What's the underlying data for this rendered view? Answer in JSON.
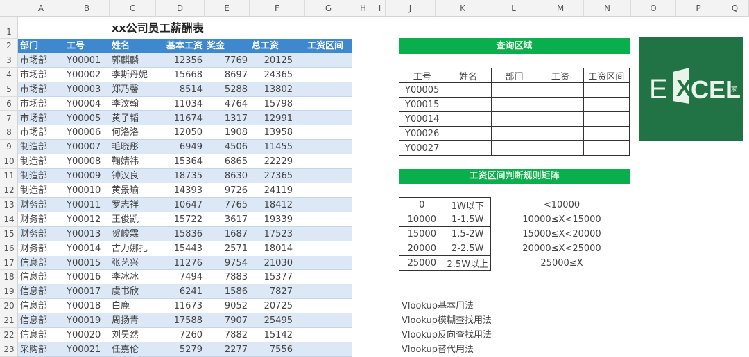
{
  "columns": [
    "A",
    "B",
    "C",
    "D",
    "E",
    "F",
    "G",
    "H",
    "I",
    "J",
    "K",
    "L",
    "M",
    "N",
    "O",
    "P",
    "Q"
  ],
  "salary_table": {
    "title": "xx公司员工薪酬表",
    "headers": [
      "部门",
      "工号",
      "姓名",
      "基本工资",
      "奖金",
      "总工资",
      "工资区间"
    ],
    "rows": [
      [
        "市场部",
        "Y00001",
        "郭麒麟",
        "12356",
        "7769",
        "20125"
      ],
      [
        "市场部",
        "Y00002",
        "李斯丹妮",
        "15668",
        "8697",
        "24365"
      ],
      [
        "市场部",
        "Y00003",
        "郑乃馨",
        "8514",
        "5288",
        "13802"
      ],
      [
        "市场部",
        "Y00004",
        "李汶翰",
        "11034",
        "4764",
        "15798"
      ],
      [
        "市场部",
        "Y00005",
        "黄子韬",
        "11674",
        "1317",
        "12991"
      ],
      [
        "市场部",
        "Y00006",
        "何洛洛",
        "12050",
        "1908",
        "13958"
      ],
      [
        "制造部",
        "Y00007",
        "毛晓彤",
        "6949",
        "4506",
        "11455"
      ],
      [
        "制造部",
        "Y00008",
        "鞠婧祎",
        "15364",
        "6865",
        "22229"
      ],
      [
        "制造部",
        "Y00009",
        "钟汉良",
        "18735",
        "8630",
        "27365"
      ],
      [
        "制造部",
        "Y00010",
        "黄景瑜",
        "14393",
        "9726",
        "24119"
      ],
      [
        "财务部",
        "Y00011",
        "罗志祥",
        "10647",
        "7765",
        "18412"
      ],
      [
        "财务部",
        "Y00012",
        "王俊凯",
        "15722",
        "3617",
        "19339"
      ],
      [
        "财务部",
        "Y00013",
        "贺峻霖",
        "15836",
        "1687",
        "17523"
      ],
      [
        "财务部",
        "Y00014",
        "古力娜扎",
        "15443",
        "2571",
        "18014"
      ],
      [
        "信息部",
        "Y00015",
        "张艺兴",
        "11276",
        "9754",
        "21030"
      ],
      [
        "信息部",
        "Y00016",
        "李冰冰",
        "7494",
        "7883",
        "15377"
      ],
      [
        "信息部",
        "Y00017",
        "虞书欣",
        "6241",
        "1586",
        "7827"
      ],
      [
        "信息部",
        "Y00018",
        "白鹿",
        "11673",
        "9052",
        "20725"
      ],
      [
        "信息部",
        "Y00019",
        "周扬青",
        "17588",
        "7907",
        "25495"
      ],
      [
        "信息部",
        "Y00020",
        "刘昊然",
        "7260",
        "7882",
        "15142"
      ],
      [
        "采购部",
        "Y00021",
        "任嘉伦",
        "5279",
        "2277",
        "7556"
      ]
    ]
  },
  "query": {
    "title": "查询区域",
    "headers": [
      "工号",
      "姓名",
      "部门",
      "工资",
      "工资区间"
    ],
    "ids": [
      "Y00005",
      "Y00015",
      "Y00014",
      "Y00026",
      "Y00027"
    ]
  },
  "rules": {
    "title": "工资区间判断规则矩阵",
    "rows": [
      [
        "0",
        "1W以下"
      ],
      [
        "10000",
        "1-1.5W"
      ],
      [
        "15000",
        "1.5-2W"
      ],
      [
        "20000",
        "2-2.5W"
      ],
      [
        "25000",
        "2.5W以上"
      ]
    ],
    "descriptions": [
      "<10000",
      "10000≤X<15000",
      "15000≤X<20000",
      "20000≤X<25000",
      "25000≤X"
    ]
  },
  "notes": [
    "Vlookup基本用法",
    "Vlookup模糊查找用法",
    "Vlookup反向查找用法",
    "Vlookup替代用法"
  ],
  "logo": {
    "text": "EXCEL",
    "suffix": "家"
  },
  "colors": {
    "header_blue": "#3e88cf",
    "band_blue": "#dce8f5",
    "green": "#0aae4c",
    "logo_green": "#217346"
  }
}
